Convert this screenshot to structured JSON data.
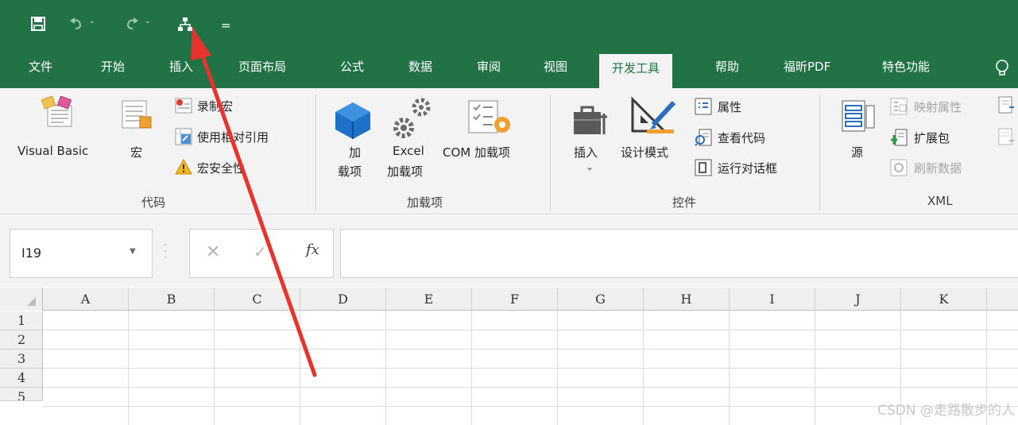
{
  "quick_access": {
    "icons": [
      "save-icon",
      "undo-icon",
      "redo-icon",
      "network-diagram-icon",
      "customize-dropdown-icon"
    ],
    "customize_glyph": "="
  },
  "tabs": [
    {
      "label": "文件",
      "active": false
    },
    {
      "label": "开始",
      "active": false
    },
    {
      "label": "插入",
      "active": false
    },
    {
      "label": "页面布局",
      "active": false
    },
    {
      "label": "公式",
      "active": false
    },
    {
      "label": "数据",
      "active": false
    },
    {
      "label": "审阅",
      "active": false
    },
    {
      "label": "视图",
      "active": false
    },
    {
      "label": "开发工具",
      "active": true
    },
    {
      "label": "帮助",
      "active": false
    },
    {
      "label": "福昕PDF",
      "active": false
    },
    {
      "label": "特色功能",
      "active": false
    }
  ],
  "ribbon": {
    "code": {
      "group_label": "代码",
      "visual_basic": "Visual Basic",
      "macros": "宏",
      "record_macro": "录制宏",
      "relative_refs": "使用相对引用",
      "macro_security": "宏安全性"
    },
    "addins": {
      "group_label": "加载项",
      "addins_line1": "加",
      "addins_line2": "载项",
      "excel_addins_line1": "Excel",
      "excel_addins_line2": "加载项",
      "com_addins": "COM 加载项"
    },
    "controls": {
      "group_label": "控件",
      "insert": "插入",
      "design_mode": "设计模式",
      "properties": "属性",
      "view_code": "查看代码",
      "run_dialog": "运行对话框"
    },
    "xml": {
      "group_label": "XML",
      "source": "源",
      "map_properties": "映射属性",
      "expansion_packs": "扩展包",
      "refresh_data": "刷新数据"
    }
  },
  "formula_bar": {
    "name_box": "I19",
    "fx_label": "fx",
    "cancel_glyph": "✕",
    "enter_glyph": "✓",
    "formula": ""
  },
  "sheet": {
    "columns": [
      "A",
      "B",
      "C",
      "D",
      "E",
      "F",
      "G",
      "H",
      "I",
      "J",
      "K"
    ],
    "rows": [
      "1",
      "2",
      "3",
      "4",
      "5"
    ]
  },
  "watermark": "CSDN @走路散步的人",
  "colors": {
    "accent_green": "#217346",
    "annotation_arrow": "#e8322c"
  }
}
